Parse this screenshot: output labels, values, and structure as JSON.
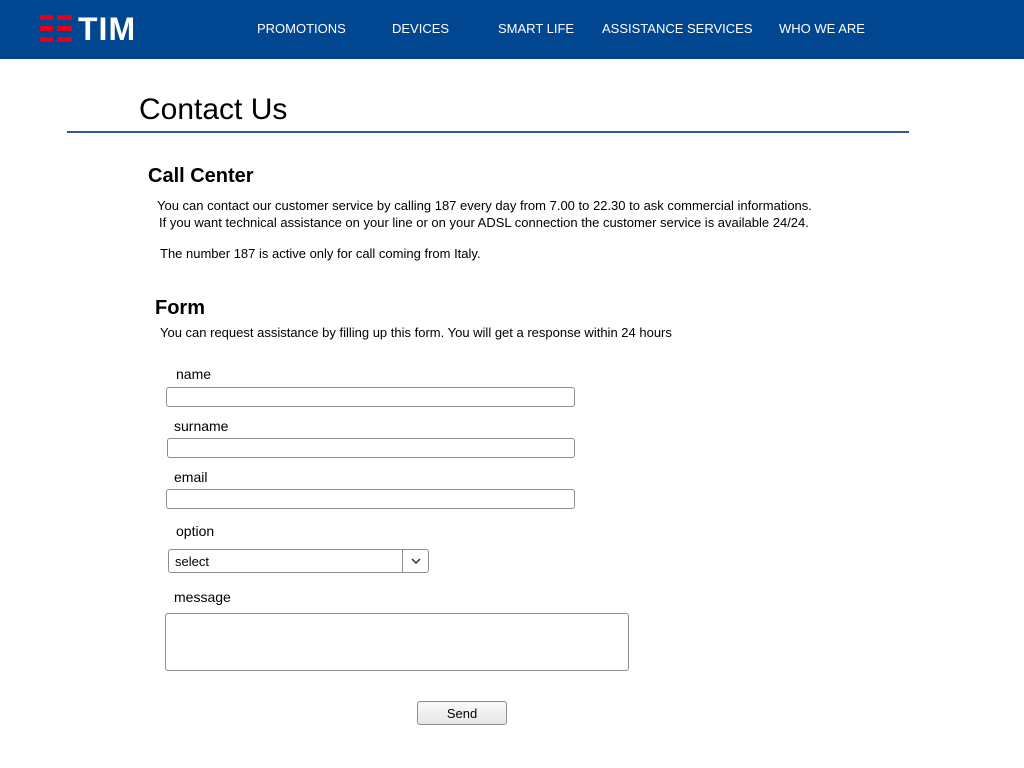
{
  "header": {
    "logo_text": "TIM",
    "brand_color": "#004691",
    "logo_mark_color": "#e2001a",
    "nav": [
      {
        "label": "PROMOTIONS"
      },
      {
        "label": "DEVICES"
      },
      {
        "label": "SMART LIFE"
      },
      {
        "label": "ASSISTANCE SERVICES"
      },
      {
        "label": "WHO WE ARE"
      }
    ]
  },
  "page": {
    "title": "Contact Us",
    "rule_color": "#3355a8"
  },
  "call_center": {
    "heading": "Call Center",
    "line1": "You can contact our customer service by calling 187 every day from 7.00 to 22.30 to ask commercial informations.",
    "line2": "If you want technical assistance on your line or on your ADSL connection the customer service is available 24/24.",
    "note": "The number 187 is active only for call coming from Italy."
  },
  "form": {
    "heading": "Form",
    "intro": "You can request assistance by filling up this form. You will get a response within 24 hours",
    "name_label": "name",
    "name_value": "",
    "surname_label": "surname",
    "surname_value": "",
    "email_label": "email",
    "email_value": "",
    "option_label": "option",
    "option_selected": "select",
    "message_label": "message",
    "message_value": "",
    "send_label": "Send"
  }
}
